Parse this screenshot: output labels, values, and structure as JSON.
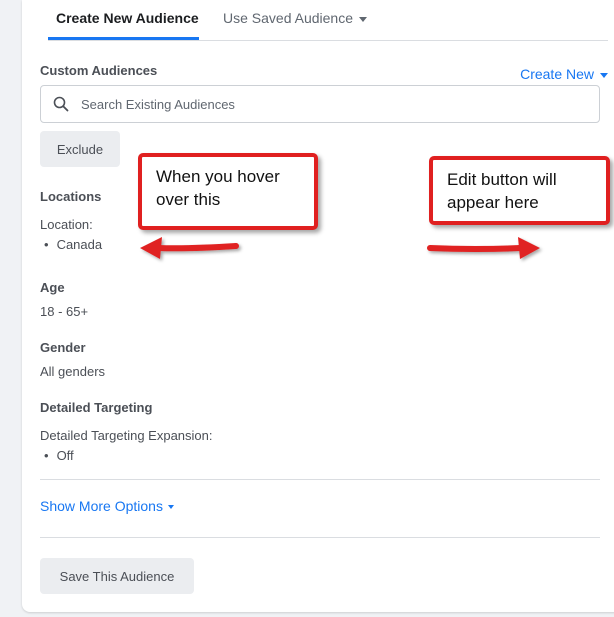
{
  "tabs": [
    {
      "label": "Create New Audience",
      "active": true
    },
    {
      "label": "Use Saved Audience",
      "active": false
    }
  ],
  "custom_audiences": {
    "title": "Custom Audiences",
    "create_new_label": "Create New",
    "search_placeholder": "Search Existing Audiences",
    "search_value": "",
    "exclude_label": "Exclude"
  },
  "locations": {
    "title": "Locations",
    "label": "Location:",
    "items": [
      "Canada"
    ]
  },
  "age": {
    "title": "Age",
    "value": "18 - 65+"
  },
  "gender": {
    "title": "Gender",
    "value": "All genders"
  },
  "detailed_targeting": {
    "title": "Detailed Targeting",
    "label": "Detailed Targeting Expansion:",
    "items": [
      "Off"
    ]
  },
  "show_more_label": "Show More Options",
  "save_label": "Save This Audience",
  "annotations": {
    "left": [
      "When you hover",
      "over this"
    ],
    "right": [
      "Edit button will",
      "appear here"
    ],
    "color": "#e02020"
  },
  "colors": {
    "accent": "#1877f2",
    "panel": "#ffffff",
    "background": "#f0f2f5",
    "button": "#ebedf0"
  }
}
